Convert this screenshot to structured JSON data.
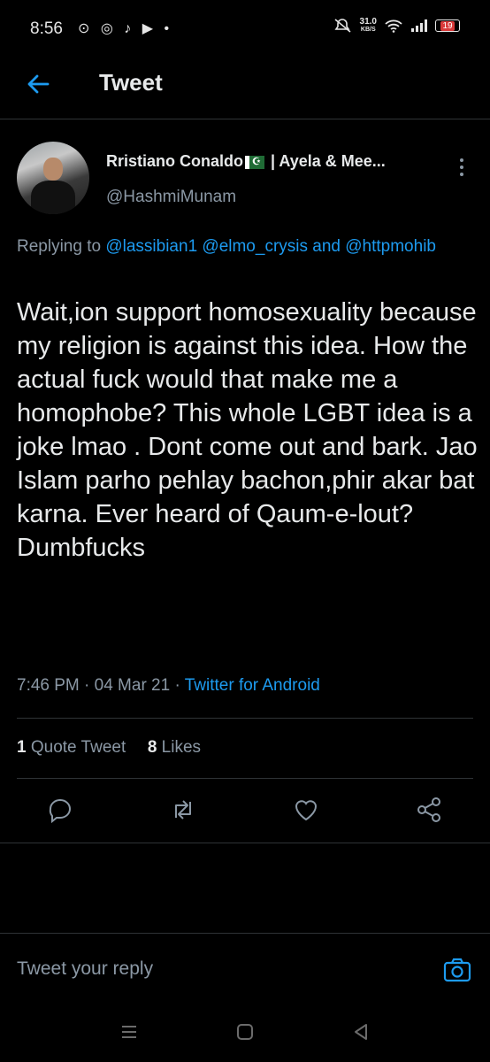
{
  "status_bar": {
    "time": "8:56",
    "left_icons": "⊙ ◎ ♪ ▶ •",
    "speed_value": "31.0",
    "speed_unit": "KB/S",
    "battery": "19"
  },
  "header": {
    "title": "Tweet"
  },
  "tweet": {
    "author_name_a": "Rristiano Conaldo",
    "flag_glyph": "☪",
    "author_name_b": " | Ayela & Mee...",
    "handle": "@HashmiMunam",
    "replying_prefix": "Replying to ",
    "reply_mentions": "@lassibian1 @elmo_crysis and @httpmohib",
    "text": "Wait,ion support homosexuality because my religion is against this idea. How the actual fuck would that make me a homophobe? This whole LGBT idea is a joke lmao . Dont come out and bark. Jao Islam parho pehlay bachon,phir akar bat karna. Ever heard of Qaum-e-lout?\nDumbfucks",
    "timestamp": "7:46 PM · 04 Mar 21 · ",
    "source": "Twitter for Android",
    "quote_count": "1",
    "quote_label": " Quote Tweet",
    "likes_count": "8",
    "likes_label": " Likes"
  },
  "reply": {
    "placeholder": "Tweet your reply"
  },
  "colors": {
    "accent": "#1d9bf0",
    "muted": "#8b98a5",
    "background": "#000000"
  },
  "icons": [
    "back-arrow-icon",
    "more-options-icon",
    "reply-icon",
    "retweet-icon",
    "like-icon",
    "share-icon",
    "camera-icon",
    "menu-icon",
    "home-icon",
    "back-icon"
  ]
}
